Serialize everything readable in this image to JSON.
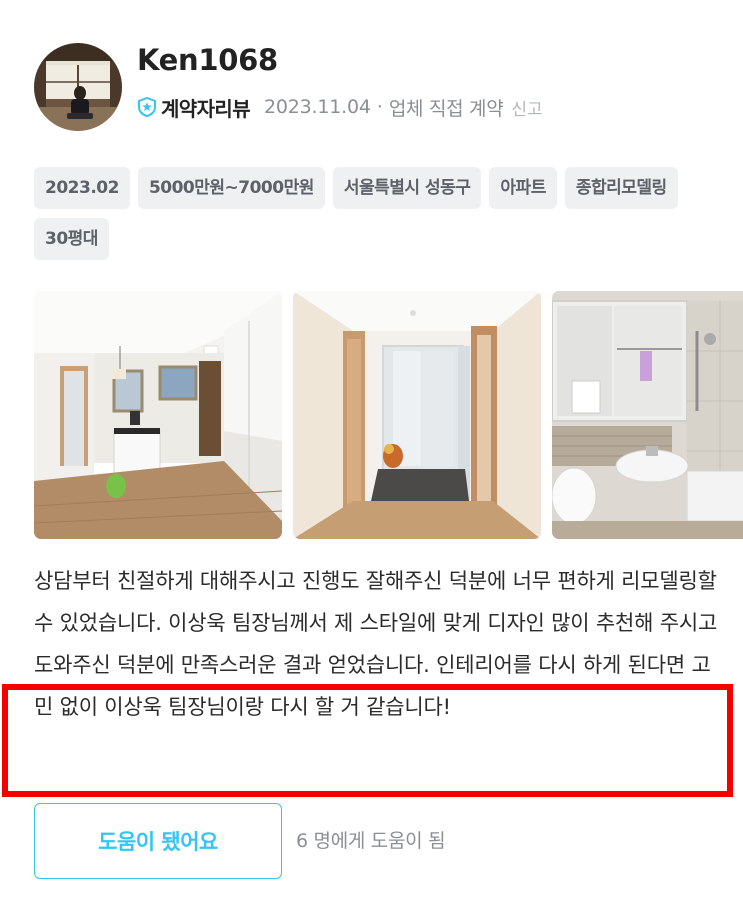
{
  "review": {
    "author": {
      "name": "Ken1068",
      "avatar_icon": "profile-photo"
    },
    "badge": {
      "icon": "verified-badge-icon",
      "label": "계약자리뷰",
      "color": "#35c5f0"
    },
    "date": "2023.11.04",
    "separator": "·",
    "contract_type": "업체 직접 계약",
    "report_label": "신고",
    "tags": [
      "2023.02",
      "5000만원~7000만원",
      "서울특별시 성동구",
      "아파트",
      "종합리모델링",
      "30평대"
    ],
    "photos": [
      {
        "icon": "living-room-photo"
      },
      {
        "icon": "hallway-photo"
      },
      {
        "icon": "bathroom-photo"
      }
    ],
    "text": "상담부터 친절하게 대해주시고 진행도 잘해주신 덕분에 너무 편하게 리모델링할 수 있었습니다. 이상욱 팀장님께서 제 스타일에 맞게 디자인 많이 추천해 주시고 도와주신 덕분에 만족스러운 결과 얻었습니다. 인테리어를 다시 하게 된다면 고민 없이 이상욱 팀장님이랑 다시 할 거 같습니다!",
    "helpful": {
      "button_label": "도움이 됐어요",
      "count_text": "6 명에게 도움이 됨"
    }
  },
  "colors": {
    "accent": "#35c5f0",
    "highlight": "#f40000",
    "tag_bg": "#eef0f2",
    "muted_text": "#8a8f96"
  }
}
